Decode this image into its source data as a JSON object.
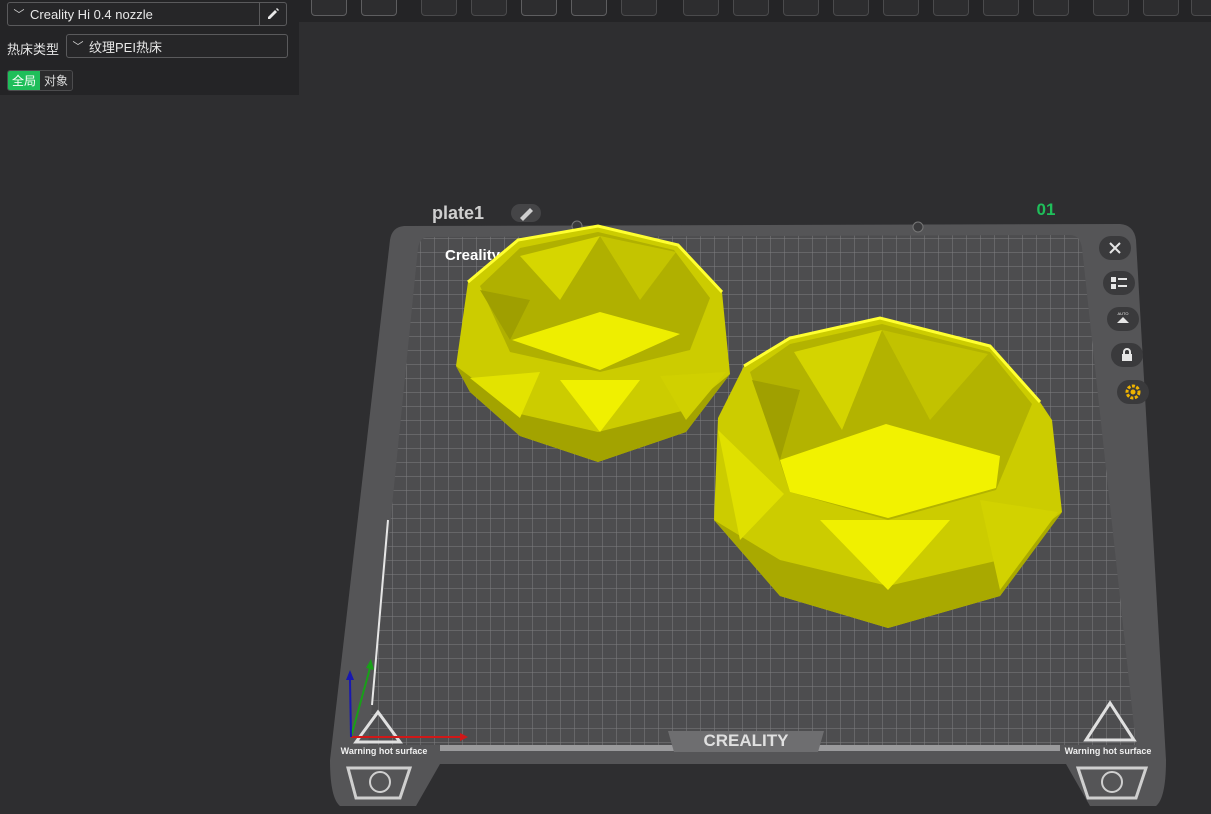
{
  "printer": {
    "selected": "Creality Hi 0.4 nozzle",
    "edit_icon": "pencil-icon"
  },
  "bed": {
    "label": "热床类型",
    "selected": "纹理PEI热床"
  },
  "scope_tabs": [
    {
      "label": "全局",
      "active": true
    },
    {
      "label": "对象",
      "active": false
    }
  ],
  "plate": {
    "name": "plate1",
    "index": "01",
    "brand_text": "Creality ... Plate",
    "logo": "CREALITY",
    "warning_left": "Warning hot surface",
    "warning_right": "Warning hot surface"
  },
  "colors": {
    "accent": "#1fbe5a",
    "model": "#e6e600",
    "bed": "#545456"
  },
  "side_tools": [
    "close-icon",
    "arrange-list-icon",
    "auto-orient-icon",
    "lock-icon",
    "settings-gear-icon"
  ]
}
